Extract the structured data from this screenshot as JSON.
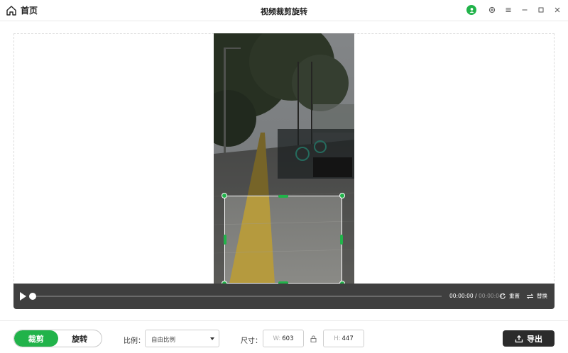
{
  "titlebar": {
    "home_label": "首页",
    "title": "视频裁剪旋转"
  },
  "editor": {
    "crop_box": {
      "width": 603,
      "height": 447
    }
  },
  "player": {
    "current_time": "00:00:00",
    "separator": "/",
    "total_time": "00:00:04",
    "progress_fraction": 0,
    "reset_label": "重置",
    "replace_label": "替换"
  },
  "toolbar": {
    "tabs": [
      {
        "label": "裁剪",
        "active": true
      },
      {
        "label": "旋转",
        "active": false
      }
    ],
    "ratio_label": "比例：",
    "ratio_value": "自由比例",
    "size_label": "尺寸：",
    "width_prefix": "W:",
    "width_value": "603",
    "height_prefix": "H:",
    "height_value": "447",
    "export_label": "导出"
  },
  "colors": {
    "accent": "#21b34a",
    "player_bg": "#3f3f3f",
    "export_bg": "#2b2b2b"
  },
  "icons": [
    "home-icon",
    "user-avatar-icon",
    "settings-icon",
    "menu-icon",
    "minimize-icon",
    "maximize-icon",
    "close-icon",
    "play-icon",
    "reset-icon",
    "replace-icon",
    "lock-icon",
    "export-icon"
  ]
}
